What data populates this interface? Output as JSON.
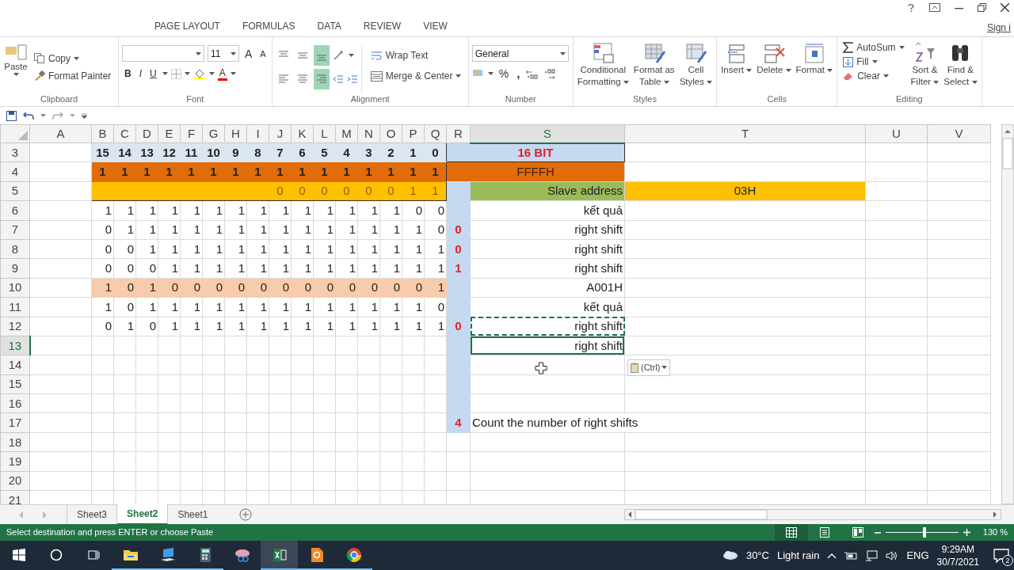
{
  "ribbon_tabs": [
    {
      "label": "PAGE LAYOUT",
      "selected": false
    },
    {
      "label": "FORMULAS",
      "selected": false
    },
    {
      "label": "DATA",
      "selected": false
    },
    {
      "label": "REVIEW",
      "selected": false
    },
    {
      "label": "VIEW",
      "selected": false
    }
  ],
  "account": "Sign i",
  "ribbon": {
    "clipboard": {
      "paste": "Paste",
      "copy": "Copy",
      "format_painter": "Format Painter",
      "label": "Clipboard"
    },
    "font": {
      "size": "11",
      "grow": "A",
      "shrink": "A",
      "bold": "B",
      "italic": "I",
      "underline": "U",
      "font_color": "A",
      "label": "Font"
    },
    "alignment": {
      "align_buttons": [
        {
          "kind": "top",
          "selected": false
        },
        {
          "kind": "middle",
          "selected": false
        },
        {
          "kind": "bottom",
          "selected": true
        },
        {
          "kind": "left",
          "selected": false
        },
        {
          "kind": "center",
          "selected": false
        },
        {
          "kind": "right",
          "selected": true
        }
      ],
      "wrap_text": "Wrap Text",
      "merge_center": "Merge & Center",
      "label": "Alignment"
    },
    "number": {
      "format": "General",
      "percent": "%",
      "comma": ",",
      "label": "Number"
    },
    "styles": {
      "buttons": [
        {
          "kind": "conditional",
          "lines": [
            "Conditional",
            "Formatting"
          ]
        },
        {
          "kind": "table",
          "lines": [
            "Format as",
            "Table"
          ]
        },
        {
          "kind": "cellstyles",
          "lines": [
            "Cell",
            "Styles"
          ]
        }
      ],
      "label": "Styles"
    },
    "cells": {
      "buttons": [
        {
          "kind": "insert",
          "lines": [
            "Insert"
          ]
        },
        {
          "kind": "delete",
          "lines": [
            "Delete"
          ]
        },
        {
          "kind": "format",
          "lines": [
            "Format"
          ]
        }
      ],
      "label": "Cells"
    },
    "editing": {
      "autosum": "AutoSum",
      "fill": "Fill",
      "clear": "Clear",
      "buttons": [
        {
          "kind": "sort",
          "lines": [
            "Sort &",
            "Filter"
          ]
        },
        {
          "kind": "find",
          "lines": [
            "Find &",
            "Select"
          ]
        }
      ],
      "label": "Editing"
    }
  },
  "columns": [
    {
      "label": "A",
      "selected": false
    },
    {
      "label": "B",
      "selected": false
    },
    {
      "label": "C",
      "selected": false
    },
    {
      "label": "D",
      "selected": false
    },
    {
      "label": "E",
      "selected": false
    },
    {
      "label": "F",
      "selected": false
    },
    {
      "label": "G",
      "selected": false
    },
    {
      "label": "H",
      "selected": false
    },
    {
      "label": "I",
      "selected": false
    },
    {
      "label": "J",
      "selected": false
    },
    {
      "label": "K",
      "selected": false
    },
    {
      "label": "L",
      "selected": false
    },
    {
      "label": "M",
      "selected": false
    },
    {
      "label": "N",
      "selected": false
    },
    {
      "label": "O",
      "selected": false
    },
    {
      "label": "P",
      "selected": false
    },
    {
      "label": "Q",
      "selected": false
    },
    {
      "label": "R",
      "selected": false
    },
    {
      "label": "S",
      "selected": true
    },
    {
      "label": "T",
      "selected": false
    },
    {
      "label": "U",
      "selected": false
    },
    {
      "label": "V",
      "selected": false
    }
  ],
  "rows": [
    {
      "number": "3",
      "selected": false,
      "kind": "bit_labels",
      "bits": [
        "15",
        "14",
        "13",
        "12",
        "11",
        "10",
        "9",
        "8",
        "7",
        "6",
        "5",
        "4",
        "3",
        "2",
        "1",
        "0"
      ],
      "merged_label": "16 BIT",
      "copied": false
    },
    {
      "number": "4",
      "selected": false,
      "kind": "mask",
      "bits": [
        "1",
        "1",
        "1",
        "1",
        "1",
        "1",
        "1",
        "1",
        "1",
        "1",
        "1",
        "1",
        "1",
        "1",
        "1",
        "1"
      ],
      "merged_label": "FFFFH",
      "copied": false
    },
    {
      "number": "5",
      "selected": false,
      "kind": "address",
      "low_byte": [
        "0",
        "0",
        "0",
        "0",
        "0",
        "0",
        "1",
        "1"
      ],
      "r_shaded": true,
      "s": "Slave address",
      "t": "03H",
      "copied": false
    },
    {
      "number": "6",
      "selected": false,
      "kind": "plain",
      "bits": [
        "1",
        "1",
        "1",
        "1",
        "1",
        "1",
        "1",
        "1",
        "1",
        "1",
        "1",
        "1",
        "1",
        "1",
        "0",
        "0"
      ],
      "r_shaded": true,
      "s": "kết quả",
      "copied": false
    },
    {
      "number": "7",
      "selected": false,
      "kind": "plain",
      "bits": [
        "0",
        "1",
        "1",
        "1",
        "1",
        "1",
        "1",
        "1",
        "1",
        "1",
        "1",
        "1",
        "1",
        "1",
        "1",
        "0"
      ],
      "r_shaded": true,
      "r": "0",
      "s": "right shift",
      "copied": false
    },
    {
      "number": "8",
      "selected": false,
      "kind": "plain",
      "bits": [
        "0",
        "0",
        "1",
        "1",
        "1",
        "1",
        "1",
        "1",
        "1",
        "1",
        "1",
        "1",
        "1",
        "1",
        "1",
        "1"
      ],
      "r_shaded": true,
      "r": "0",
      "s": "right shift",
      "copied": false
    },
    {
      "number": "9",
      "selected": false,
      "kind": "plain",
      "bits": [
        "0",
        "0",
        "0",
        "1",
        "1",
        "1",
        "1",
        "1",
        "1",
        "1",
        "1",
        "1",
        "1",
        "1",
        "1",
        "1"
      ],
      "r_shaded": true,
      "r": "1",
      "s": "right shift",
      "copied": false
    },
    {
      "number": "10",
      "selected": false,
      "kind": "result",
      "bits": [
        "1",
        "0",
        "1",
        "0",
        "0",
        "0",
        "0",
        "0",
        "0",
        "0",
        "0",
        "0",
        "0",
        "0",
        "0",
        "1"
      ],
      "r_shaded": true,
      "s": "A001H",
      "copied": false
    },
    {
      "number": "11",
      "selected": false,
      "kind": "plain",
      "bits": [
        "1",
        "0",
        "1",
        "1",
        "1",
        "1",
        "1",
        "1",
        "1",
        "1",
        "1",
        "1",
        "1",
        "1",
        "1",
        "0"
      ],
      "r_shaded": true,
      "s": "kết quả",
      "copied": false
    },
    {
      "number": "12",
      "selected": false,
      "kind": "plain",
      "bits": [
        "0",
        "1",
        "0",
        "1",
        "1",
        "1",
        "1",
        "1",
        "1",
        "1",
        "1",
        "1",
        "1",
        "1",
        "1",
        "1"
      ],
      "r_shaded": true,
      "r": "0",
      "s": "right shift",
      "copied": true
    },
    {
      "number": "13",
      "selected": true,
      "kind": "plain",
      "r_shaded": true,
      "s": "right shift",
      "copied": false
    },
    {
      "number": "14",
      "selected": false,
      "kind": "plain",
      "r_shaded": true,
      "copied": false
    },
    {
      "number": "15",
      "selected": false,
      "kind": "plain",
      "r_shaded": true,
      "copied": false
    },
    {
      "number": "16",
      "selected": false,
      "kind": "plain",
      "r_shaded": true,
      "copied": false
    },
    {
      "number": "17",
      "selected": false,
      "kind": "note",
      "r_shaded": true,
      "r": "4",
      "s": "Count the number of right shifts",
      "copied": false
    },
    {
      "number": "18",
      "selected": false,
      "kind": "plain",
      "r_shaded": false,
      "copied": false
    },
    {
      "number": "19",
      "selected": false,
      "kind": "plain",
      "r_shaded": false,
      "copied": false
    },
    {
      "number": "20",
      "selected": false,
      "kind": "plain",
      "r_shaded": false,
      "copied": false
    },
    {
      "number": "21",
      "selected": false,
      "kind": "plain",
      "r_shaded": false,
      "copied": false
    }
  ],
  "paste_options": {
    "label": "(Ctrl)"
  },
  "sheet_tabs": [
    {
      "label": "Sheet3",
      "selected": false
    },
    {
      "label": "Sheet2",
      "selected": true
    },
    {
      "label": "Sheet1",
      "selected": false
    }
  ],
  "status_bar": {
    "message": "Select destination and press ENTER or choose Paste",
    "views": [
      {
        "kind": "normal",
        "selected": true
      },
      {
        "kind": "page_layout",
        "selected": false
      },
      {
        "kind": "page_break",
        "selected": false
      }
    ],
    "zoom": {
      "level": 0.54
    },
    "zoom_label": "130 %"
  },
  "taskbar": {
    "apps": [
      {
        "kind": "explorer",
        "running": true,
        "active": false
      },
      {
        "kind": "computer",
        "running": true,
        "active": false
      },
      {
        "kind": "calculator",
        "running": true,
        "active": false
      },
      {
        "kind": "snipping",
        "running": false,
        "active": false
      },
      {
        "kind": "excel",
        "running": true,
        "active": true
      },
      {
        "kind": "reader",
        "running": true,
        "active": false
      },
      {
        "kind": "browser",
        "running": true,
        "active": false
      }
    ],
    "weather": {
      "temperature": "30°C",
      "condition": "Light rain"
    },
    "language": "ENG",
    "time": "9:29AM",
    "date": "30/7/2021",
    "notifications": "2"
  }
}
